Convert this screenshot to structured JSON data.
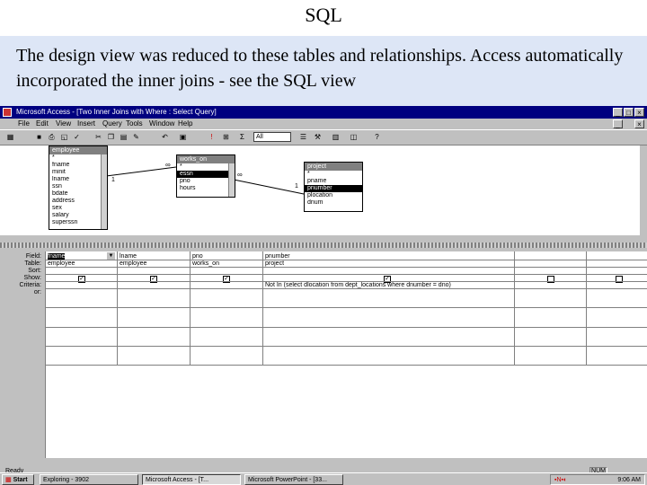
{
  "slide": {
    "title": "SQL",
    "text": "The design view was reduced to these tables and relationships. Access automatically incorporated the inner joins - see the SQL view"
  },
  "window": {
    "title": "Microsoft Access - [Two Inner Joins with Where : Select Query]",
    "controls": [
      "_",
      "□",
      "×"
    ]
  },
  "menu": [
    "File",
    "Edit",
    "View",
    "Insert",
    "Query",
    "Tools",
    "Window",
    "Help"
  ],
  "toolbar": {
    "top_values": "All",
    "icons": [
      "view-icon",
      "save-icon",
      "print-icon",
      "preview-icon",
      "spelling-icon",
      "cut-icon",
      "copy-icon",
      "paste-icon",
      "format-painter-icon",
      "undo-icon",
      "query-type-icon",
      "run-icon",
      "show-table-icon",
      "totals-icon",
      "properties-icon",
      "build-icon",
      "database-window-icon",
      "new-object-icon",
      "help-icon"
    ]
  },
  "tables": [
    {
      "name": "employee",
      "fields": [
        "*",
        "fname",
        "minit",
        "lname",
        "ssn",
        "bdate",
        "address",
        "sex",
        "salary",
        "superssn"
      ],
      "selected": ""
    },
    {
      "name": "works_on",
      "fields": [
        "*",
        "essn",
        "pno",
        "hours"
      ],
      "selected": "essn"
    },
    {
      "name": "project",
      "fields": [
        "*",
        "pname",
        "pnumber",
        "plocation",
        "dnum"
      ],
      "selected": "pnumber"
    }
  ],
  "joins": [
    {
      "left_label": "1",
      "right_label": "∞"
    },
    {
      "left_label": "∞",
      "right_label": "1"
    }
  ],
  "grid": {
    "row_labels": [
      "Field:",
      "Table:",
      "Sort:",
      "Show:",
      "Criteria:",
      "or:"
    ],
    "columns": [
      {
        "field": "fname",
        "table": "employee",
        "show": true,
        "criteria": ""
      },
      {
        "field": "lname",
        "table": "employee",
        "show": true,
        "criteria": ""
      },
      {
        "field": "pno",
        "table": "works_on",
        "show": true,
        "criteria": ""
      },
      {
        "field": "pnumber",
        "table": "project",
        "show": true,
        "criteria": "Not In (select dlocation from dept_locations where dnumber = dno)"
      },
      {
        "field": "",
        "table": "",
        "show": false,
        "criteria": ""
      },
      {
        "field": "",
        "table": "",
        "show": false,
        "criteria": ""
      }
    ]
  },
  "status": {
    "mode": "Ready",
    "num": "NUM"
  },
  "taskbar": {
    "start": "Start",
    "tasks": [
      "Exploring - 3902",
      "Microsoft Access - [T...",
      "Microsoft PowerPoint - [33..."
    ],
    "clock": "9:06 AM"
  }
}
